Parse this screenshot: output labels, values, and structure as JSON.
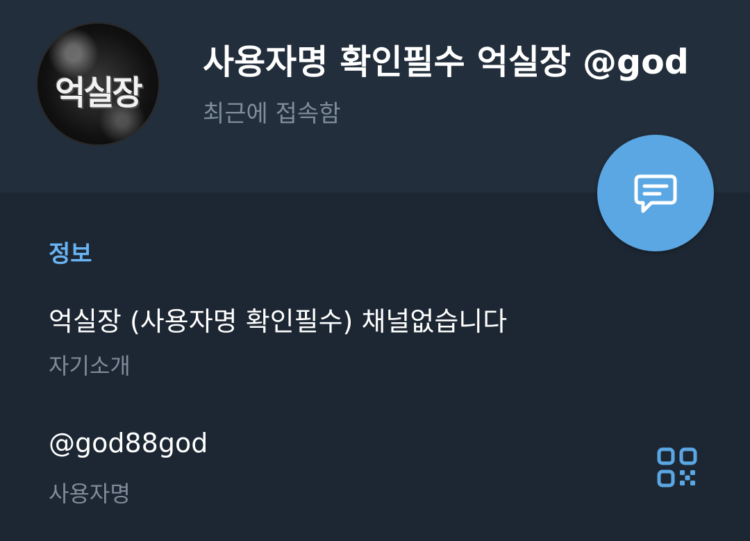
{
  "header": {
    "avatar_text": "억실장",
    "title": "사용자명 확인필수 억실장 @god",
    "status": "최근에 접속함",
    "message_icon": "message-icon"
  },
  "info": {
    "section_title": "정보",
    "bio_value": "억실장 (사용자명 확인필수) 채널없습니다",
    "bio_label": "자기소개",
    "username_value": "@god88god",
    "username_label": "사용자명",
    "qr_icon": "qr-code-icon"
  },
  "colors": {
    "accent": "#6ab3f3",
    "fab": "#5aa7e3",
    "header_bg": "#222e3b",
    "body_bg": "#1d2733",
    "secondary_text": "#7f8c99"
  }
}
